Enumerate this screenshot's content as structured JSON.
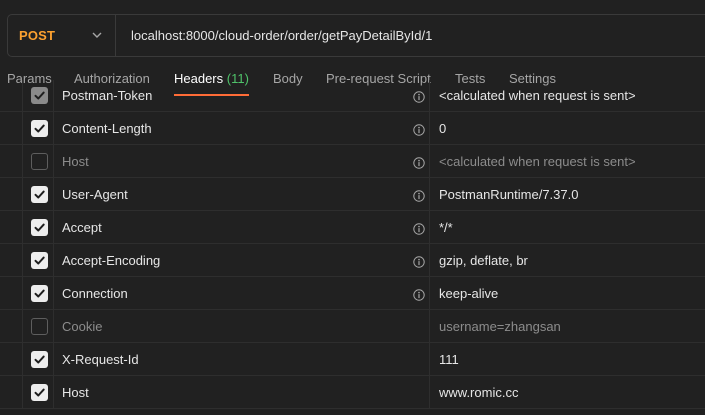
{
  "request": {
    "method": "POST",
    "url": "localhost:8000/cloud-order/order/getPayDetailById/1"
  },
  "tabs": [
    {
      "label": "Params"
    },
    {
      "label": "Authorization"
    },
    {
      "label": "Headers",
      "count": "(11)",
      "active": true
    },
    {
      "label": "Body"
    },
    {
      "label": "Pre-request Script"
    },
    {
      "label": "Tests"
    },
    {
      "label": "Settings"
    }
  ],
  "headers": [
    {
      "key": "Postman-Token",
      "value": "<calculated when request is sent>",
      "enabled": true,
      "auto": true,
      "info": true
    },
    {
      "key": "Content-Length",
      "value": "0",
      "enabled": true,
      "info": true
    },
    {
      "key": "Host",
      "value": "<calculated when request is sent>",
      "enabled": false,
      "info": true
    },
    {
      "key": "User-Agent",
      "value": "PostmanRuntime/7.37.0",
      "enabled": true,
      "info": true
    },
    {
      "key": "Accept",
      "value": "*/*",
      "enabled": true,
      "info": true
    },
    {
      "key": "Accept-Encoding",
      "value": "gzip, deflate, br",
      "enabled": true,
      "info": true
    },
    {
      "key": "Connection",
      "value": "keep-alive",
      "enabled": true,
      "info": true
    },
    {
      "key": "Cookie",
      "value": "username=zhangsan",
      "enabled": false,
      "info": false
    },
    {
      "key": "X-Request-Id",
      "value": "111",
      "enabled": true,
      "info": false
    },
    {
      "key": "Host",
      "value": "www.romic.cc",
      "enabled": true,
      "info": false
    }
  ],
  "colors": {
    "method": "#fca130",
    "count": "#4fc36a",
    "tab_underline": "#ff6c37"
  }
}
